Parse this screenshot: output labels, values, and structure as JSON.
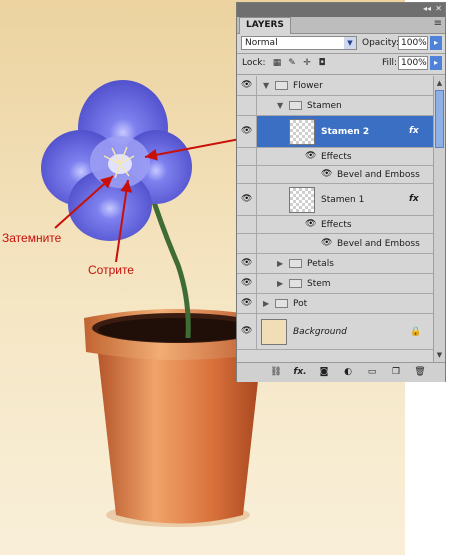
{
  "annotations": {
    "darken_label": "Затемните",
    "erase_label": "Сотрите"
  },
  "layers_panel": {
    "tab_label": "LAYERS",
    "blend_mode": "Normal",
    "opacity_label": "Opacity:",
    "opacity_value": "100%",
    "lock_label": "Lock:",
    "fill_label": "Fill:",
    "fill_value": "100%",
    "layers": {
      "flower": "Flower",
      "stamen_group": "Stamen",
      "stamen2": "Stamen 2",
      "effects": "Effects",
      "bevel": "Bevel and Emboss",
      "stamen1": "Stamen 1",
      "petals": "Petals",
      "stem": "Stem",
      "pot": "Pot",
      "background": "Background"
    },
    "fx_badge": "fx",
    "bottom_fx_label": "fx."
  },
  "colors": {
    "accent_selected": "#3a6fc4",
    "annotation_red": "#c8100a",
    "flower": "#5b5fd9",
    "pot": "#d97a3a",
    "background_tan": "#f1e0b8"
  },
  "icons": [
    "eye-icon",
    "folder-icon",
    "link-icon",
    "layer-style-icon",
    "mask-icon",
    "adjustment-icon",
    "new-group-icon",
    "new-layer-icon",
    "trash-icon",
    "lock-icon",
    "panel-menu-icon"
  ]
}
